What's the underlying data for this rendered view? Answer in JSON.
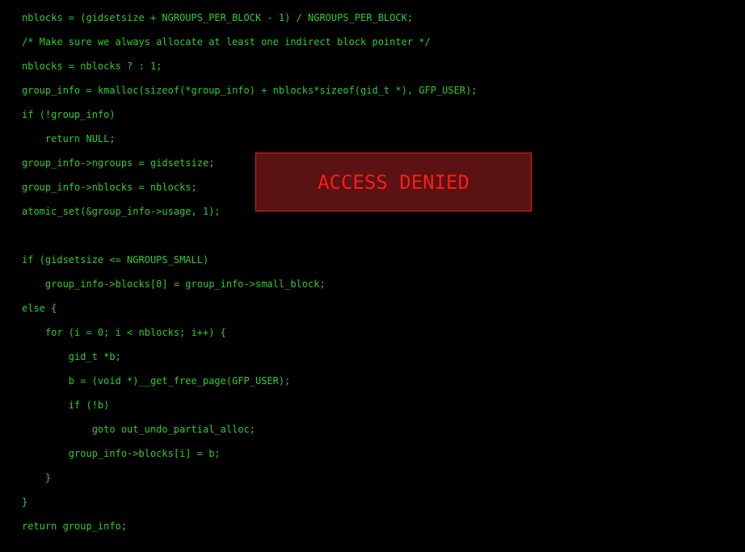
{
  "code_lines": [
    "nblocks = (gidsetsize + NGROUPS_PER_BLOCK - 1) / NGROUPS_PER_BLOCK;",
    "/* Make sure we always allocate at least one indirect block pointer */",
    "nblocks = nblocks ? : 1;",
    "group_info = kmalloc(sizeof(*group_info) + nblocks*sizeof(gid_t *), GFP_USER);",
    "if (!group_info)",
    "    return NULL;",
    "group_info->ngroups = gidsetsize;",
    "group_info->nblocks = nblocks;",
    "atomic_set(&group_info->usage, 1);",
    "",
    "if (gidsetsize <= NGROUPS_SMALL)",
    "    group_info->blocks[0] = group_info->small_block;",
    "else {",
    "    for (i = 0; i < nblocks; i++) {",
    "        gid_t *b;",
    "        b = (void *)__get_free_page(GFP_USER);",
    "        if (!b)",
    "            goto out_undo_partial_alloc;",
    "        group_info->blocks[i] = b;",
    "    }",
    "}",
    "return group_info;"
  ],
  "alert": {
    "message": "ACCESS DENIED"
  },
  "colors": {
    "background": "#000000",
    "code_text": "#2ecc2e",
    "alert_background": "#5a1212",
    "alert_border": "#e02020",
    "alert_text": "#ff1a1a"
  }
}
